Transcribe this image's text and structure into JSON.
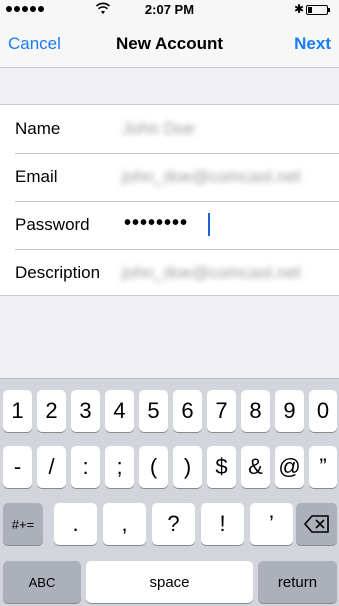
{
  "status_bar": {
    "time": "2:07 PM"
  },
  "nav": {
    "cancel": "Cancel",
    "title": "New Account",
    "next": "Next"
  },
  "form": {
    "name_label": "Name",
    "name_value": "John Doe",
    "email_label": "Email",
    "email_value": "john_doe@comcast.net",
    "password_label": "Password",
    "password_value": "••••••••",
    "description_label": "Description",
    "description_value": "john_doe@comcast.net"
  },
  "keyboard": {
    "row1": [
      "1",
      "2",
      "3",
      "4",
      "5",
      "6",
      "7",
      "8",
      "9",
      "0"
    ],
    "row2": [
      "-",
      "/",
      ":",
      ";",
      "(",
      ")",
      "$",
      "&",
      "@",
      "”"
    ],
    "row3_mode": "#+=",
    "row3": [
      ".",
      ",",
      "?",
      "!",
      "’"
    ],
    "delete_icon": "backspace-icon",
    "abc": "ABC",
    "space": "space",
    "return": "return"
  }
}
